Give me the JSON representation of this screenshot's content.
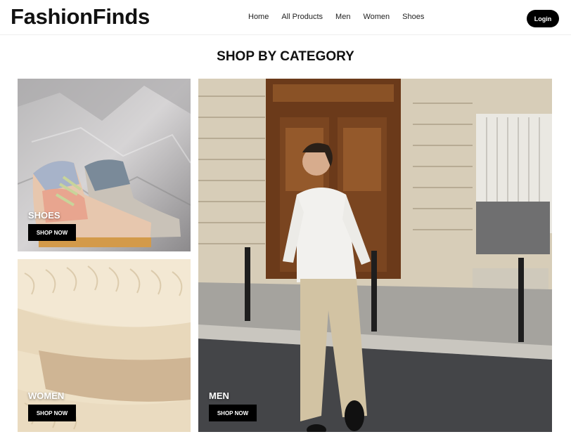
{
  "brand": {
    "name": "FashionFinds"
  },
  "nav": {
    "items": [
      {
        "label": "Home"
      },
      {
        "label": "All Products"
      },
      {
        "label": "Men"
      },
      {
        "label": "Women"
      },
      {
        "label": "Shoes"
      }
    ],
    "login_label": "Login"
  },
  "section": {
    "title": "SHOP BY CATEGORY"
  },
  "categories": {
    "shoes": {
      "label": "SHOES",
      "cta": "SHOP NOW"
    },
    "women": {
      "label": "WOMEN",
      "cta": "SHOP NOW"
    },
    "men": {
      "label": "MEN",
      "cta": "SHOP NOW"
    }
  },
  "colors": {
    "accent": "#000000",
    "text": "#111111",
    "background": "#ffffff"
  }
}
